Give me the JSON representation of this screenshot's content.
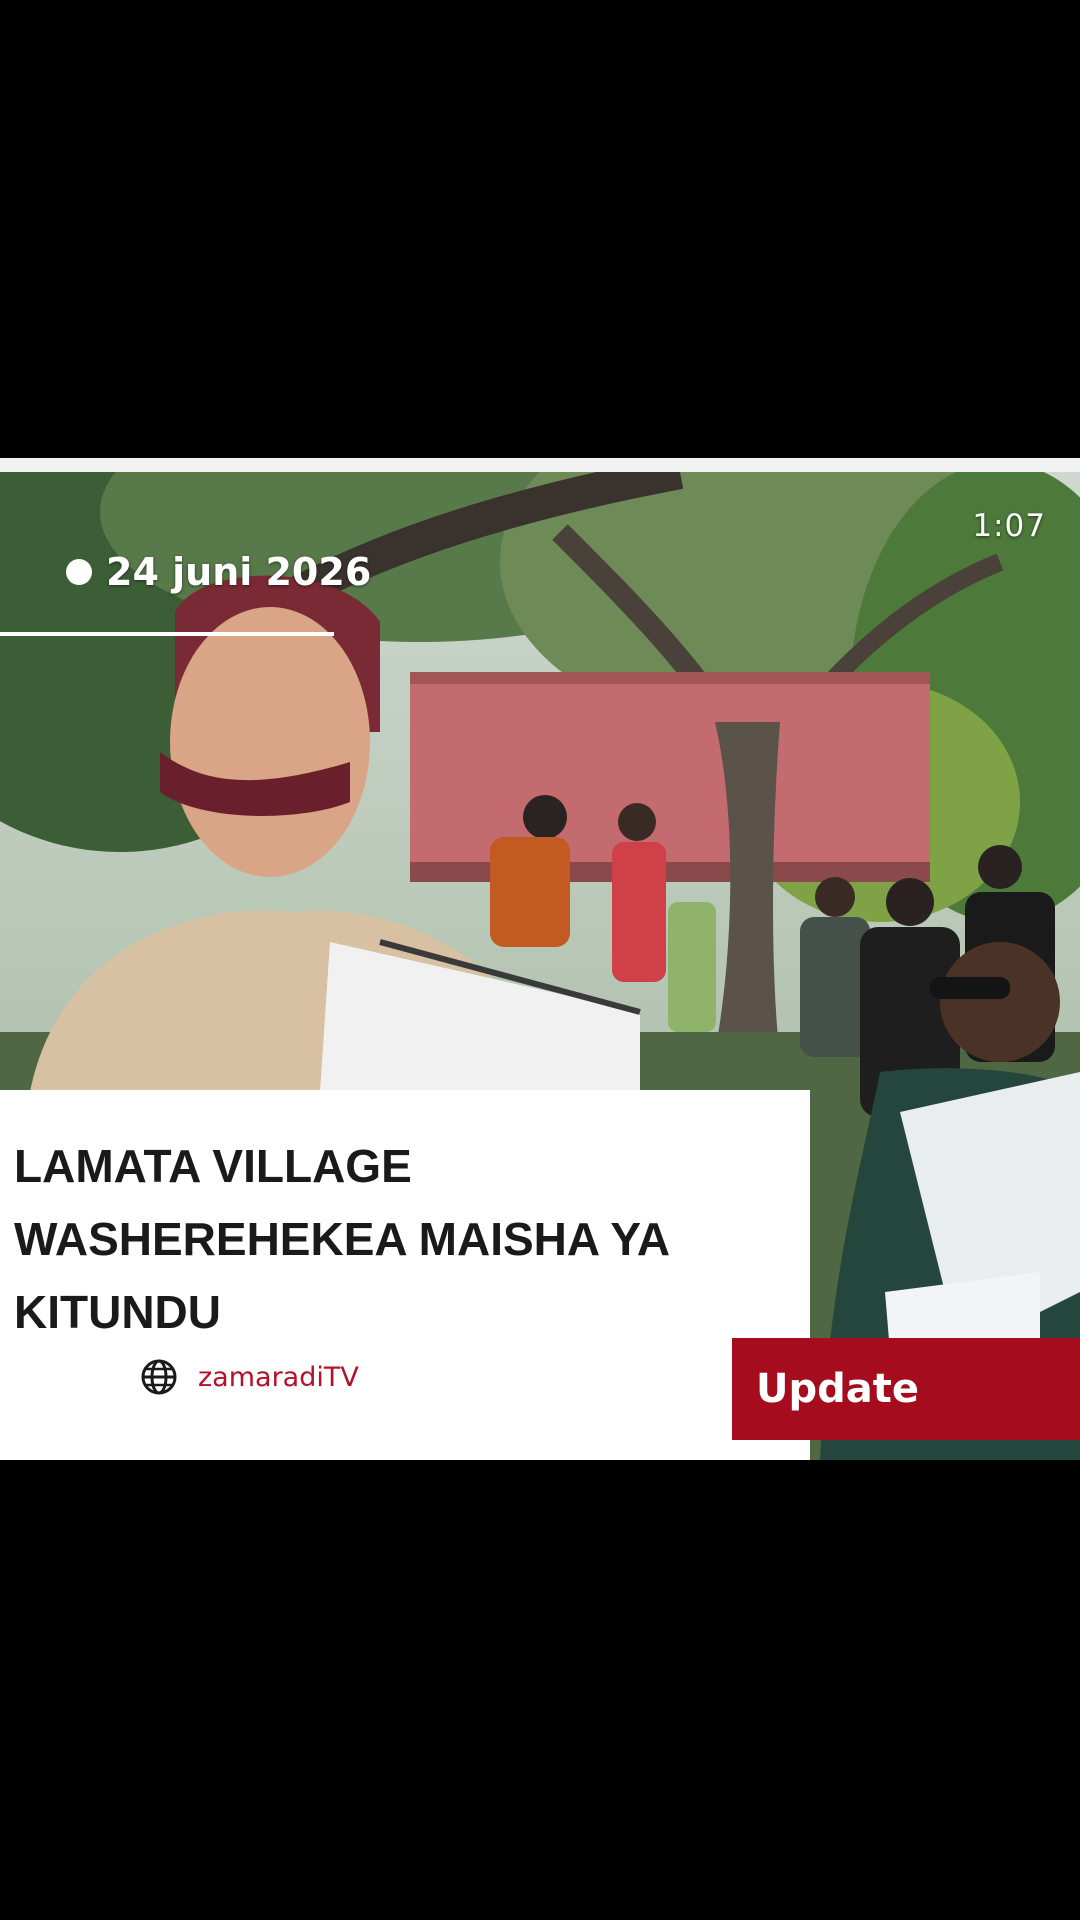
{
  "video": {
    "elapsed_time": "1:07",
    "date_label": "24 juni 2026",
    "headline": "LAMATA VILLAGE\nWASHEREHEKEA MAISHA YA\nKITUNDU",
    "source_icon": "globe-icon",
    "source_label": "zamaradiTV",
    "update_label": "Update"
  },
  "colors": {
    "accent_red": "#a50d1e",
    "source_text": "#b3122a",
    "panel_bg": "#ffffff",
    "letterbox": "#000000"
  }
}
